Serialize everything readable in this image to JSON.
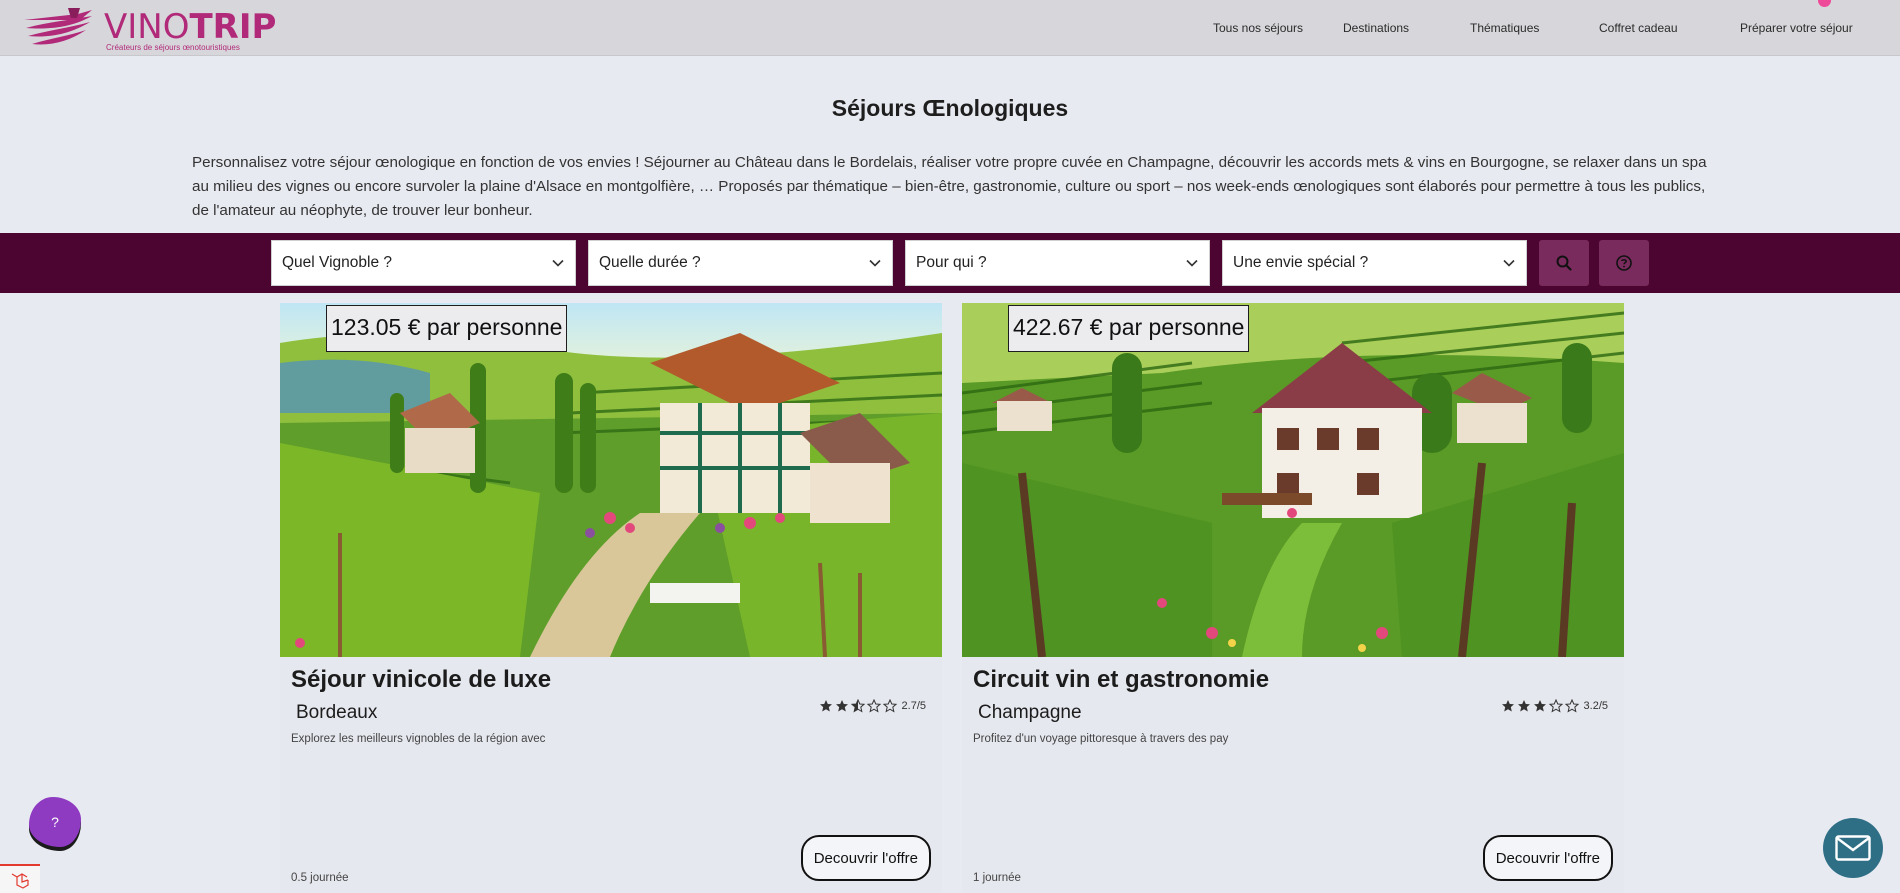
{
  "brand": {
    "name_part1": "VINO",
    "name_part2": "TRIP",
    "tagline": "Créateurs de séjours œnotouristiques",
    "color": "#b12a79"
  },
  "nav": {
    "items": [
      {
        "label": "Tous nos séjours"
      },
      {
        "label": "Destinations"
      },
      {
        "label": "Thématiques"
      },
      {
        "label": "Coffret cadeau"
      },
      {
        "label": "Préparer votre séjour"
      }
    ]
  },
  "intro": {
    "title": "Séjours Œnologiques",
    "text": "Personnalisez votre séjour œnologique en fonction de vos envies ! Séjourner au Château dans le Bordelais, réaliser votre propre cuvée en Champagne, découvrir les accords mets & vins en Bourgogne, se relaxer dans un spa au milieu des vignes ou encore survoler la plaine d'Alsace en montgolfière, … Proposés par thématique – bien-être, gastronomie, culture ou sport – nos week-ends œnologiques sont élaborés pour permettre à tous les publics, de l'amateur au néophyte, de trouver leur bonheur."
  },
  "filters": {
    "vignoble": "Quel Vignoble ?",
    "duree": "Quelle durée ?",
    "pour_qui": "Pour qui ?",
    "envie": "Une envie spécial ?",
    "search_icon": "search-icon",
    "help_icon": "question-circle-icon",
    "bar_color": "#4c0430",
    "button_color": "#7a2b5d"
  },
  "cards": [
    {
      "price": "123.05 € par personne",
      "title": "Séjour vinicole de luxe",
      "region": "Bordeaux",
      "description": "Explorez les meilleurs vignobles de la région avec",
      "rating_value": 2.7,
      "rating_text": "2.7/5",
      "button": "Decouvrir l'offre",
      "duration": "0.5 journée"
    },
    {
      "price": "422.67 € par personne",
      "title": "Circuit vin et gastronomie",
      "region": "Champagne",
      "description": "Profitez d'un voyage pittoresque à travers des pay",
      "rating_value": 3.2,
      "rating_text": "3.2/5",
      "button": "Decouvrir l'offre",
      "duration": "1 journée"
    }
  ],
  "widgets": {
    "help_label": "?",
    "help_color": "#8e3bc2",
    "chat_icon": "mail-icon",
    "chat_color": "#2f6f86"
  }
}
